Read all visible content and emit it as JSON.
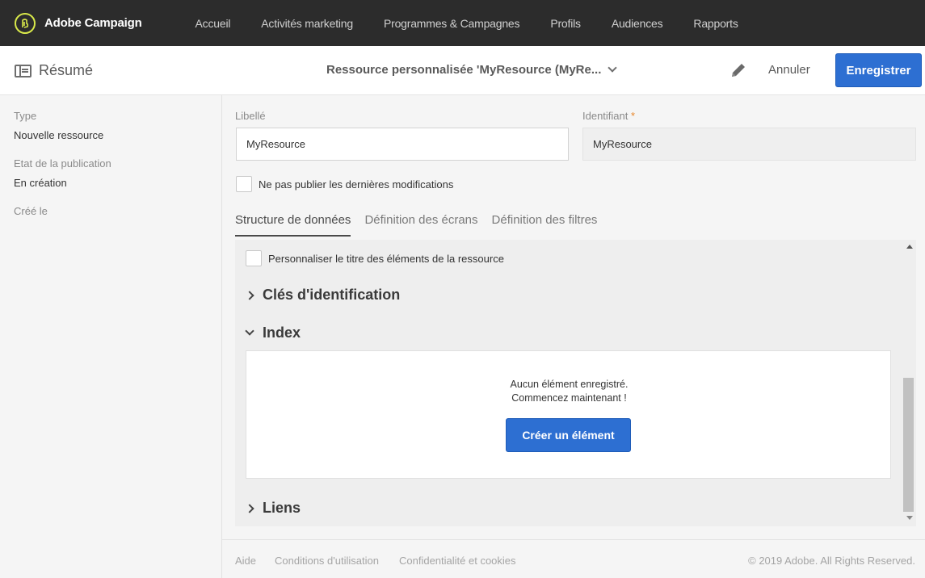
{
  "app": {
    "name": "Adobe Campaign",
    "logo_icon": "adobe-campaign-logo"
  },
  "nav": {
    "items": [
      {
        "label": "Accueil"
      },
      {
        "label": "Activités marketing"
      },
      {
        "label": "Programmes & Campagnes"
      },
      {
        "label": "Profils"
      },
      {
        "label": "Audiences"
      },
      {
        "label": "Rapports"
      }
    ]
  },
  "header": {
    "summary_label": "Résumé",
    "resource_title": "Ressource personnalisée 'MyResource (MyRe...",
    "cancel_label": "Annuler",
    "save_label": "Enregistrer"
  },
  "sidebar": {
    "type_label": "Type",
    "type_value": "Nouvelle ressource",
    "status_label": "Etat de la publication",
    "status_value": "En création",
    "created_label": "Créé le"
  },
  "form": {
    "libelle_label": "Libellé",
    "libelle_value": "MyResource",
    "identifiant_label": "Identifiant",
    "identifiant_required": "*",
    "identifiant_value": "MyResource",
    "no_publish_label": "Ne pas publier les dernières modifications"
  },
  "tabs": [
    {
      "label": "Structure de données",
      "active": true
    },
    {
      "label": "Définition des écrans",
      "active": false
    },
    {
      "label": "Définition des filtres",
      "active": false
    }
  ],
  "structure": {
    "customize_title_label": "Personnaliser le titre des éléments de la ressource",
    "sections": {
      "keys": "Clés d'identification",
      "index": "Index",
      "links": "Liens"
    },
    "empty_line1": "Aucun élément enregistré.",
    "empty_line2": "Commencez maintenant !",
    "create_label": "Créer un élément"
  },
  "footer": {
    "help": "Aide",
    "terms": "Conditions d'utilisation",
    "privacy": "Confidentialité et cookies",
    "copyright": "© 2019 Adobe. All Rights Reserved."
  },
  "colors": {
    "accent": "#2d6fd2",
    "topbar": "#2c2c2c",
    "logo_ring": "#d8e84a"
  }
}
